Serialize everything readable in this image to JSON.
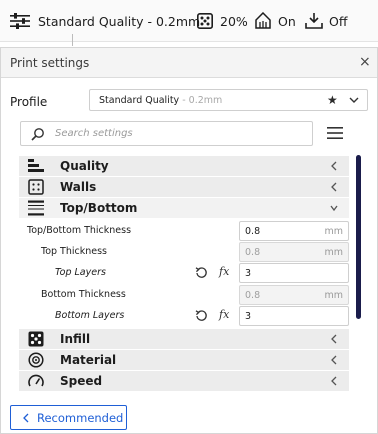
{
  "header": {
    "profile_name": "Standard Quality - 0.2mm",
    "infill": "20%",
    "support": "On",
    "adhesion": "Off"
  },
  "panel": {
    "title": "Print settings",
    "close_label": "×",
    "profile_label": "Profile",
    "profile_value": "Standard Quality",
    "profile_suffix": " - 0.2mm",
    "favorite_icon": "★",
    "search_placeholder": "Search settings"
  },
  "categories": {
    "quality": "Quality",
    "walls": "Walls",
    "topbottom": "Top/Bottom",
    "infill": "Infill",
    "material": "Material",
    "speed": "Speed"
  },
  "settings": [
    {
      "label": "Top/Bottom Thickness",
      "value": "0.8",
      "unit": "mm"
    },
    {
      "label": "Top Thickness",
      "value": "0.8",
      "unit": "mm"
    },
    {
      "label": "Top Layers",
      "value": "3",
      "unit": ""
    },
    {
      "label": "Bottom Thickness",
      "value": "0.8",
      "unit": "mm"
    },
    {
      "label": "Bottom Layers",
      "value": "3",
      "unit": ""
    }
  ],
  "fx_label": "fx",
  "recommended_label": "Recommended",
  "colors": {
    "accent": "#1f5fd6",
    "scrollbar": "#1a1c4b",
    "category_bg": "#ececec"
  }
}
